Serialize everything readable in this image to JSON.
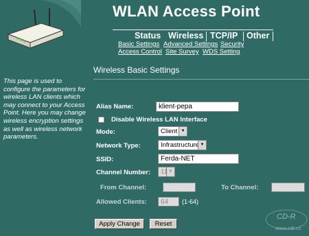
{
  "header": {
    "title": "WLAN Access Point",
    "nav": {
      "main": [
        "Status",
        "Wireless",
        "TCP/IP",
        "Other"
      ],
      "sub_row1": [
        "Basic Settings",
        "Advanced Settings",
        "Security"
      ],
      "sub_row2": [
        "Access Control",
        "Site Survey",
        "WDS Setting"
      ]
    }
  },
  "sidebar": {
    "help": "This page is used to configure the parameters for wireless LAN clients which may connect to your Access Point. Here you may change wireless encryption settings as well as wireless network parameters."
  },
  "main": {
    "title": "Wireless Basic Settings",
    "alias": {
      "label": "Alias Name:",
      "value": "klient-pepa"
    },
    "disable_wlan": {
      "label": "Disable Wireless LAN Interface",
      "checked": false
    },
    "mode": {
      "label": "Mode:",
      "value": "Client"
    },
    "network_type": {
      "label": "Network Type:",
      "value": "Infrastructure"
    },
    "ssid": {
      "label": "SSID:",
      "value": "Ferda-NET"
    },
    "channel": {
      "label": "Channel Number:",
      "value": "11"
    },
    "from_channel": {
      "label": "From Channel:",
      "value": ""
    },
    "to_channel": {
      "label": "To Channel:",
      "value": ""
    },
    "allowed_clients": {
      "label": "Allowed Clients:",
      "value": "64",
      "hint": "(1-64)"
    },
    "buttons": {
      "apply": "Apply Change",
      "reset": "Reset"
    }
  },
  "watermark": {
    "brand": "CD-R",
    "url": "www.cdr.cz"
  },
  "colors": {
    "background": "#2f6b64",
    "text": "#ffffff"
  }
}
